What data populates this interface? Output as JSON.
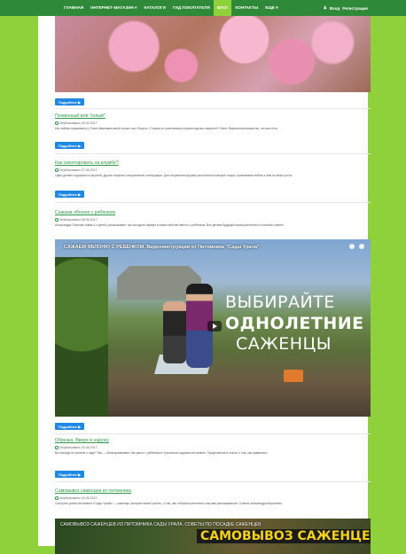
{
  "nav": {
    "items": [
      "ГЛАВНАЯ",
      "ИНТЕРНЕТ-МАГАЗИН ▾",
      "КАТАЛОГИ",
      "ГИД ПОКУПАТЕЛЯ",
      "БЛОГ",
      "КОНТАКТЫ",
      "ЕЩЕ ▾"
    ],
    "active_index": 4,
    "login": "Вход",
    "register": "Регистрация"
  },
  "buttons": {
    "more": "Подробнее ▶"
  },
  "posts": [
    {
      "title": "Почвенный или \"голый\"",
      "date": "Опубликовано 28.05.2017",
      "text": "Мы любим спрашивать у Ольга Ивановна какой лучше сорт. Вопрос: О каком-то распознании корнеплода вы говорили? Ответ: Вариантов множество, это мох есть."
    },
    {
      "title": "Как смонтировать на клумбе?",
      "date": "Опубликовано 07.06.2017",
      "text": "Одни делают подпорки из прутьев, другие покупают специальные конструкции. Для сохранения формы растения используют опоры, привязывая побеги к ним по мере роста."
    },
    {
      "title": "Сажаем яблоню с ребёнком",
      "date": "Опубликовано 08.06.2017",
      "text": "Александра Осипова, мама 4-х детей, рассказывает, как посадить первую в жизни яблоню вместе с ребёнком. Все детали будущей жизни растения и полезные советы."
    },
    {
      "title": "Обрезка. Вверх и наружу",
      "date": "Опубликовано 16.06.2017",
      "text": "Вы никогда не жалели о саде? Мы — облагораживаем. Как расти с ребенком в Уральском садовом питомнике. Продолжение в статье о том, как правильно."
    },
    {
      "title": "Самовывоз саженцев из питомника",
      "date": "Опубликовано 24.06.2017",
      "text": "Смотрите ролик питомника «Сады Урала» — саженцы, которые можно купить, о том, как отбирать растения и как ими распоряжаться. Советы Александра Кириленко."
    }
  ],
  "video": {
    "title": "САЖАЕМ ЯБЛОНЮ С РЕБЁНКОМ. Видеоинструкция от Питомника \"Сады Урала\"",
    "line1": "ВЫБИРАЙТЕ",
    "line2": "ОДНОЛЕТНИЕ",
    "line3": "САЖЕНЦЫ"
  },
  "video2": {
    "title": "САМОВЫВОЗ САЖЕНЦЕВ ИЗ ПИТОМНИКА САДЫ УРАЛА. СОВЕТЫ ПО ПОСАДКЕ САЖЕНЦЕВ",
    "big": "САМОВЫВОЗ САЖЕНЦЕВ"
  }
}
